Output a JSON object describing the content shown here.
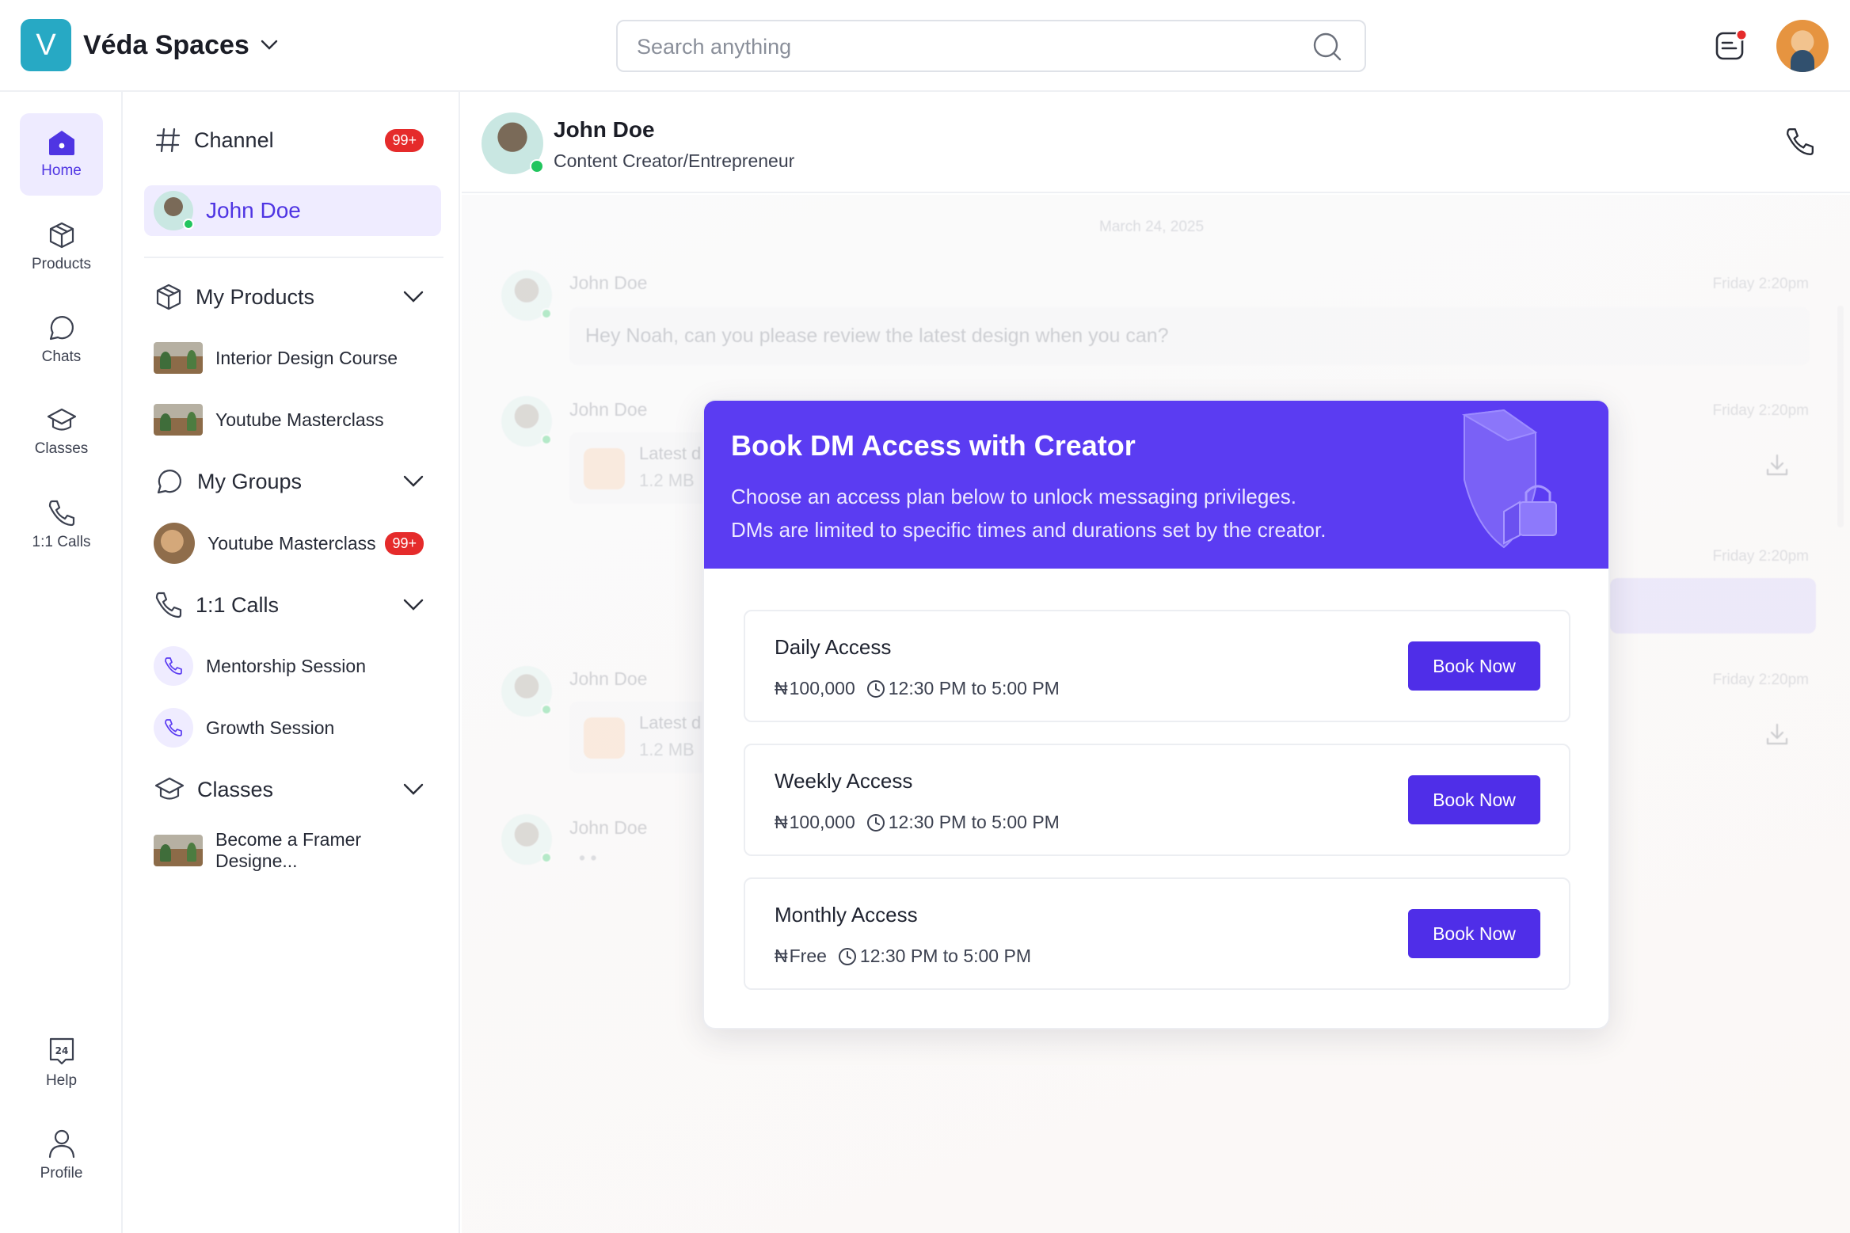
{
  "brand": {
    "logo_letter": "V",
    "name": "Véda Spaces",
    "color": "#27a9c4"
  },
  "search": {
    "placeholder": "Search anything"
  },
  "rail": {
    "items": [
      {
        "label": "Home",
        "active": true
      },
      {
        "label": "Products"
      },
      {
        "label": "Chats"
      },
      {
        "label": "Classes"
      },
      {
        "label": "1:1 Calls"
      }
    ],
    "bottom": [
      {
        "label": "Help"
      },
      {
        "label": "Profile"
      }
    ]
  },
  "sidebar": {
    "channel": {
      "label": "Channel",
      "badge": "99+"
    },
    "selected_contact": {
      "name": "John Doe"
    },
    "my_products": {
      "label": "My Products",
      "items": [
        "Interior Design Course",
        "Youtube Masterclass"
      ]
    },
    "my_groups": {
      "label": "My Groups",
      "items": [
        {
          "name": "Youtube Masterclass",
          "badge": "99+"
        }
      ]
    },
    "calls": {
      "label": "1:1 Calls",
      "items": [
        "Mentorship Session",
        "Growth Session"
      ]
    },
    "classes": {
      "label": "Classes",
      "items": [
        "Become a Framer Designe..."
      ]
    }
  },
  "chat": {
    "name": "John Doe",
    "role": "Content Creator/Entrepreneur",
    "date": "March 24, 2025",
    "messages": [
      {
        "sender": "John Doe",
        "time": "Friday 2:20pm",
        "text": "Hey Noah, can you please review the latest design when you can?"
      },
      {
        "sender": "John Doe",
        "time": "Friday 2:20pm",
        "file_title": "Latest d",
        "file_size": "1.2 MB"
      },
      {
        "time": "Friday 2:20pm"
      },
      {
        "sender": "John Doe",
        "time": "Friday 2:20pm",
        "file_title": "Latest d",
        "file_size": "1.2 MB"
      },
      {
        "sender": "John Doe",
        "typing": "• •"
      }
    ]
  },
  "modal": {
    "title": "Book DM Access with Creator",
    "desc_line1": "Choose an access plan below to unlock messaging privileges.",
    "desc_line2": "DMs are limited to specific times and durations set by the creator.",
    "header_color": "#5b3cf2",
    "plans": [
      {
        "name": "Daily Access",
        "currency": "₦",
        "price": "100,000",
        "time": "12:30 PM to 5:00 PM",
        "button": "Book Now"
      },
      {
        "name": "Weekly Access",
        "currency": "₦",
        "price": "100,000",
        "time": "12:30 PM to 5:00 PM",
        "button": "Book Now"
      },
      {
        "name": "Monthly Access",
        "currency": "₦",
        "price": "Free",
        "time": "12:30 PM to 5:00 PM",
        "button": "Book Now"
      }
    ]
  },
  "colors": {
    "accent": "#4f2ee8",
    "badge": "#e52b2b",
    "online": "#22c55e"
  }
}
